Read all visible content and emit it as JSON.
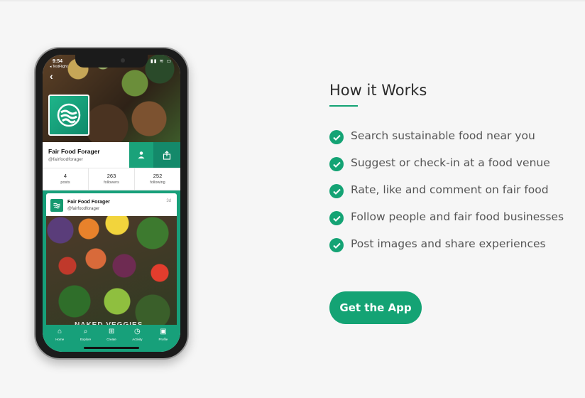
{
  "phone": {
    "status": {
      "time": "9:54",
      "carrier": "◂ TestFlight",
      "icons": "▮▮ ≋ ▭"
    },
    "profile": {
      "name": "Fair Food Forager",
      "handle": "@fairfoodforager",
      "stats": [
        {
          "value": "4",
          "label": "posts"
        },
        {
          "value": "263",
          "label": "followers"
        },
        {
          "value": "252",
          "label": "following"
        }
      ]
    },
    "post": {
      "author": "Fair Food Forager",
      "handle": "@fairfoodforager",
      "age": "3d",
      "image_text": "NAKED VEGGIES"
    },
    "tabbar": [
      {
        "label": "Home",
        "icon": "home-icon"
      },
      {
        "label": "Explore",
        "icon": "search-icon"
      },
      {
        "label": "Create",
        "icon": "plus-square-icon"
      },
      {
        "label": "Activity",
        "icon": "clock-icon"
      },
      {
        "label": "Profile",
        "icon": "avatar-icon"
      }
    ]
  },
  "how": {
    "title": "How it Works",
    "features": [
      "Search sustainable food near you",
      "Suggest or check-in at a food venue",
      "Rate, like and comment on fair food",
      "Follow people and fair food businesses",
      "Post images and share experiences"
    ],
    "cta_label": "Get the App"
  },
  "colors": {
    "accent": "#14a374",
    "background": "#f6f6f6",
    "text": "#555555"
  }
}
